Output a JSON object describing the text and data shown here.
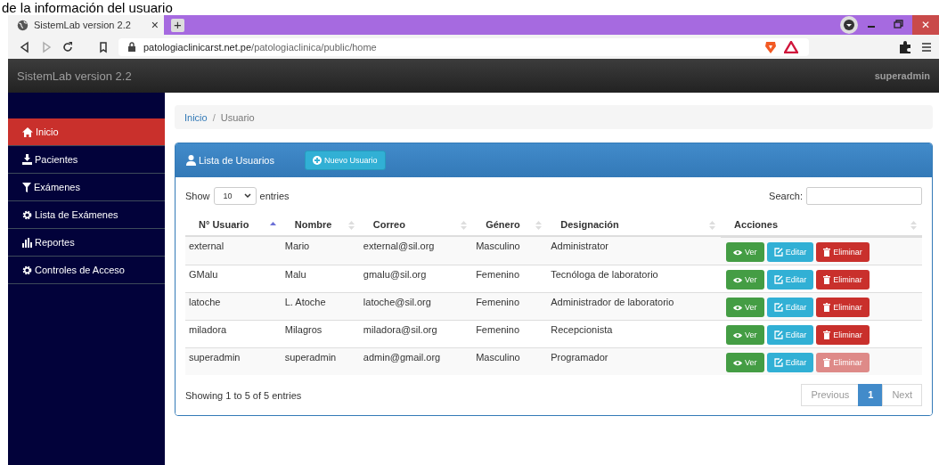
{
  "caption": "de la información del usuario",
  "browser": {
    "tab_title": "SistemLab version 2.2",
    "tab_close": "×",
    "new_tab": "+",
    "url_host": "patologiaclinicarst.net.pe",
    "url_path": "/patologiaclinica/public/home",
    "window_close": "✕"
  },
  "navbar": {
    "brand": "SistemLab version 2.2",
    "user": "superadmin"
  },
  "sidebar": {
    "items": [
      {
        "label": "Inicio",
        "selected": true
      },
      {
        "label": "Pacientes",
        "selected": false
      },
      {
        "label": "Exámenes",
        "selected": false
      },
      {
        "label": "Lista de Exámenes",
        "selected": false
      },
      {
        "label": "Reportes",
        "selected": false
      },
      {
        "label": "Controles de Acceso",
        "selected": false
      }
    ]
  },
  "breadcrumb": {
    "items": [
      {
        "label": "Inicio",
        "link": true
      },
      {
        "label": "Usuario",
        "link": false
      }
    ],
    "separator": "/"
  },
  "panel": {
    "title": "Lista de Usuarios",
    "new_button": "Nuevo Usuario"
  },
  "length": {
    "before": "Show",
    "value": "10",
    "after": "entries"
  },
  "search": {
    "label": "Search:"
  },
  "table": {
    "columns": [
      {
        "label": "N° Usuario",
        "sorted": true
      },
      {
        "label": "Nombre",
        "sorted": false
      },
      {
        "label": "Correo",
        "sorted": false
      },
      {
        "label": "Género",
        "sorted": false
      },
      {
        "label": "Designación",
        "sorted": false
      },
      {
        "label": "Acciones",
        "sorted": false
      }
    ],
    "rows": [
      {
        "cells": [
          "external",
          "Mario",
          "external@sil.org",
          "Masculino",
          "Administrator"
        ],
        "view": "Ver",
        "edit": "Editar",
        "delete": "Eliminar",
        "delete_disabled": false
      },
      {
        "cells": [
          "GMalu",
          "Malu",
          "gmalu@sil.org",
          "Femenino",
          "Tecnóloga de laboratorio"
        ],
        "view": "Ver",
        "edit": "Editar",
        "delete": "Eliminar",
        "delete_disabled": false
      },
      {
        "cells": [
          "latoche",
          "L. Atoche",
          "latoche@sil.org",
          "Femenino",
          "Administrador de laboratorio"
        ],
        "view": "Ver",
        "edit": "Editar",
        "delete": "Eliminar",
        "delete_disabled": false
      },
      {
        "cells": [
          "miladora",
          "Milagros",
          "miladora@sil.org",
          "Femenino",
          "Recepcionista"
        ],
        "view": "Ver",
        "edit": "Editar",
        "delete": "Eliminar",
        "delete_disabled": false
      },
      {
        "cells": [
          "superadmin",
          "superadmin",
          "admin@gmail.org",
          "Masculino",
          "Programador"
        ],
        "view": "Ver",
        "edit": "Editar",
        "delete": "Eliminar",
        "delete_disabled": true
      }
    ]
  },
  "info": "Showing 1 to 5 of 5 entries",
  "pagination": [
    {
      "label": "Previous",
      "disabled": true,
      "selected": false
    },
    {
      "label": "1",
      "disabled": false,
      "selected": true
    },
    {
      "label": "Next",
      "disabled": true,
      "selected": false
    }
  ]
}
